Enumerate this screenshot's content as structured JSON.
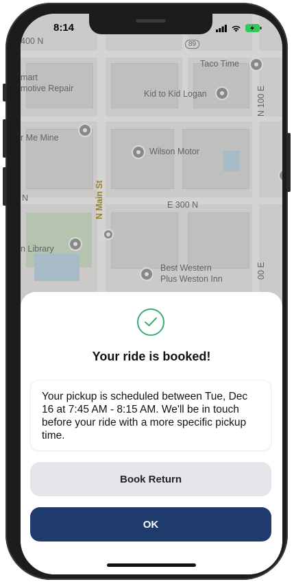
{
  "status_bar": {
    "time": "8:14"
  },
  "map": {
    "route_shield": "89",
    "labels": {
      "taco_time": "Taco Time",
      "kid_to_kid": "Kid to Kid Logan",
      "wilson_motor": "Wilson Motor",
      "n_main_st": "N Main St",
      "e_300_n": "E 300 N",
      "n_100_e_top": "N 100 E",
      "n_100_e_bottom": "00 E",
      "best_western": "Best Western",
      "plus_weston": "Plus Weston Inn",
      "library": "n Library",
      "mart": "mart",
      "automotive": "motive Repair",
      "color_me_mine": "r Me Mine",
      "n_400": "400 N",
      "n_left": "N"
    }
  },
  "sheet": {
    "title": "Your ride is booked!",
    "message": "Your pickup is scheduled between Tue, Dec 16 at 7:45 AM - 8:15 AM. We'll be in touch before your ride with a more specific pickup time.",
    "book_return_label": "Book Return",
    "ok_label": "OK"
  },
  "colors": {
    "primary": "#1e3b6b",
    "secondary": "#e6e6ea",
    "success": "#3bab72"
  },
  "icons": {
    "success": "check-circle-icon",
    "signal": "signal-icon",
    "wifi": "wifi-icon",
    "battery": "battery-charging-icon"
  }
}
